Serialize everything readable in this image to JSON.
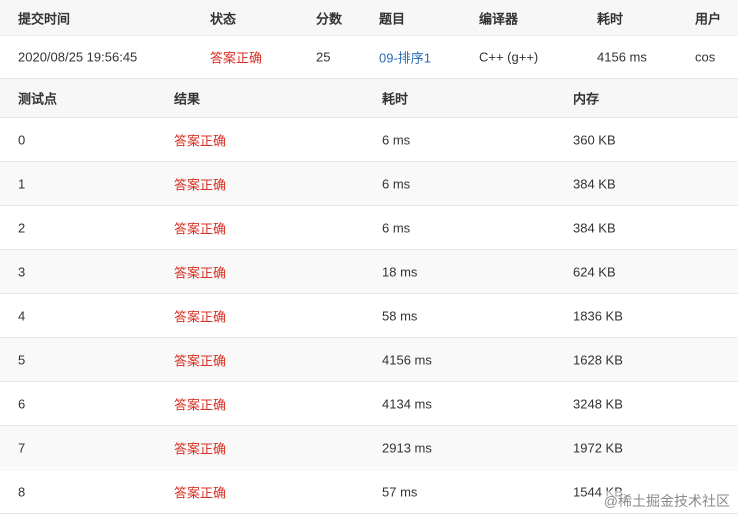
{
  "submission": {
    "headers": [
      "提交时间",
      "状态",
      "分数",
      "题目",
      "编译器",
      "耗时",
      "用户"
    ],
    "row": {
      "time": "2020/08/25 19:56:45",
      "status": "答案正确",
      "score": "25",
      "problem": "09-排序1",
      "compiler": "C++ (g++)",
      "duration": "4156 ms",
      "user": "cos"
    }
  },
  "cases": {
    "headers": [
      "测试点",
      "结果",
      "耗时",
      "内存"
    ],
    "rows": [
      {
        "id": "0",
        "result": "答案正确",
        "time": "6 ms",
        "memory": "360 KB"
      },
      {
        "id": "1",
        "result": "答案正确",
        "time": "6 ms",
        "memory": "384 KB"
      },
      {
        "id": "2",
        "result": "答案正确",
        "time": "6 ms",
        "memory": "384 KB"
      },
      {
        "id": "3",
        "result": "答案正确",
        "time": "18 ms",
        "memory": "624 KB"
      },
      {
        "id": "4",
        "result": "答案正确",
        "time": "58 ms",
        "memory": "1836 KB"
      },
      {
        "id": "5",
        "result": "答案正确",
        "time": "4156 ms",
        "memory": "1628 KB"
      },
      {
        "id": "6",
        "result": "答案正确",
        "time": "4134 ms",
        "memory": "3248 KB"
      },
      {
        "id": "7",
        "result": "答案正确",
        "time": "2913 ms",
        "memory": "1972 KB"
      },
      {
        "id": "8",
        "result": "答案正确",
        "time": "57 ms",
        "memory": "1544 KB"
      }
    ]
  },
  "watermark": "@稀土掘金技术社区",
  "colors": {
    "accepted": "#d93025",
    "link": "#2a6ab2",
    "header_bg": "#f7f7f7",
    "border": "#e6e6e6"
  }
}
